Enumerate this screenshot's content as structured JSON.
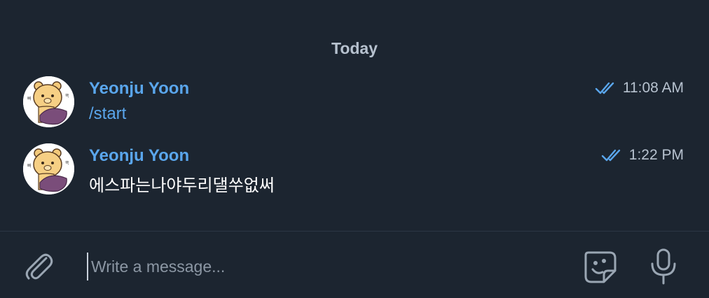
{
  "chat": {
    "date_separator": "Today",
    "messages": [
      {
        "sender": "Yeonju Yoon",
        "text": "/start",
        "time": "11:08 AM",
        "status_icon": "double-check-icon",
        "avatar_icon": "bear-sticker-avatar"
      },
      {
        "sender": "Yeonju Yoon",
        "text": "에스파는나야두리댈쑤없써",
        "time": "1:22 PM",
        "status_icon": "double-check-icon",
        "avatar_icon": "bear-sticker-avatar"
      }
    ]
  },
  "composer": {
    "placeholder": "Write a message...",
    "value": "",
    "attach_icon": "paperclip-icon",
    "sticker_icon": "sticker-emoji-icon",
    "mic_icon": "microphone-icon"
  },
  "colors": {
    "background": "#1c2530",
    "accent": "#5aa6ec",
    "muted_text": "#b7c2cf",
    "divider": "#2b3644"
  }
}
